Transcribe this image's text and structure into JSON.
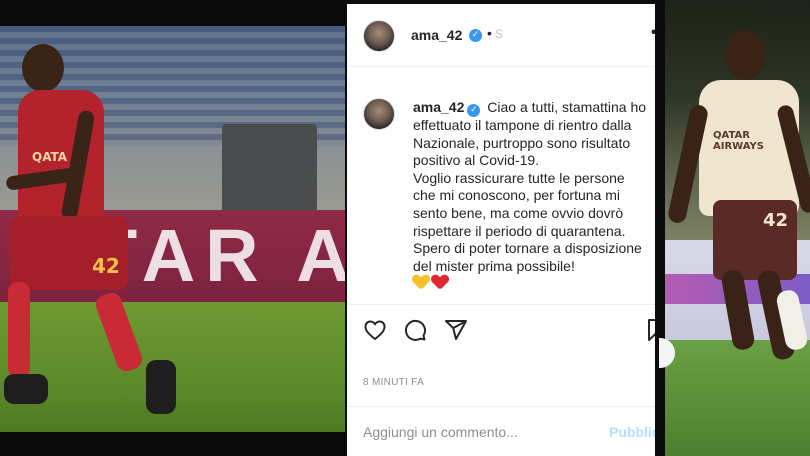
{
  "post": {
    "username": "ama_42",
    "header_dot": "•",
    "header_follow_cut": "S",
    "more_icon": "•••",
    "caption": {
      "username": "ama_42",
      "lines": [
        "Ciao a tutti, stamattina ho",
        "effettuato il tampone di rientro dalla",
        "Nazionale, purtroppo sono risultato",
        "positivo al Covid-19.",
        "Voglio rassicurare tutte le persone",
        "che mi conoscono, per fortuna mi",
        "sento bene, ma come ovvio dovrò",
        "rispettare il periodo di quarantena.",
        "Spero di poter tornare a disposizione",
        "del mister prima possibile!"
      ],
      "emojis": [
        "yellow-heart",
        "red-heart"
      ]
    },
    "timestamp": "8 MINUTI FA",
    "comment_placeholder": "Aggiungi un commento...",
    "publish_label": "Pubblica",
    "icons": [
      "heart-icon",
      "comment-icon",
      "share-icon",
      "bookmark-icon"
    ]
  },
  "photo_left": {
    "board_text": "TAR A",
    "shirt_number": "42",
    "shirt_sponsor": "QATA"
  },
  "photo_right": {
    "shirt_sponsor": "QATAR AIRWAYS",
    "shirt_number": "42"
  },
  "colors": {
    "verified_blue": "#3897f0",
    "publish_disabled": "#b2dffc",
    "roma_red": "#b4232c",
    "text_dark": "#262626",
    "text_muted": "#8e8e8e"
  }
}
